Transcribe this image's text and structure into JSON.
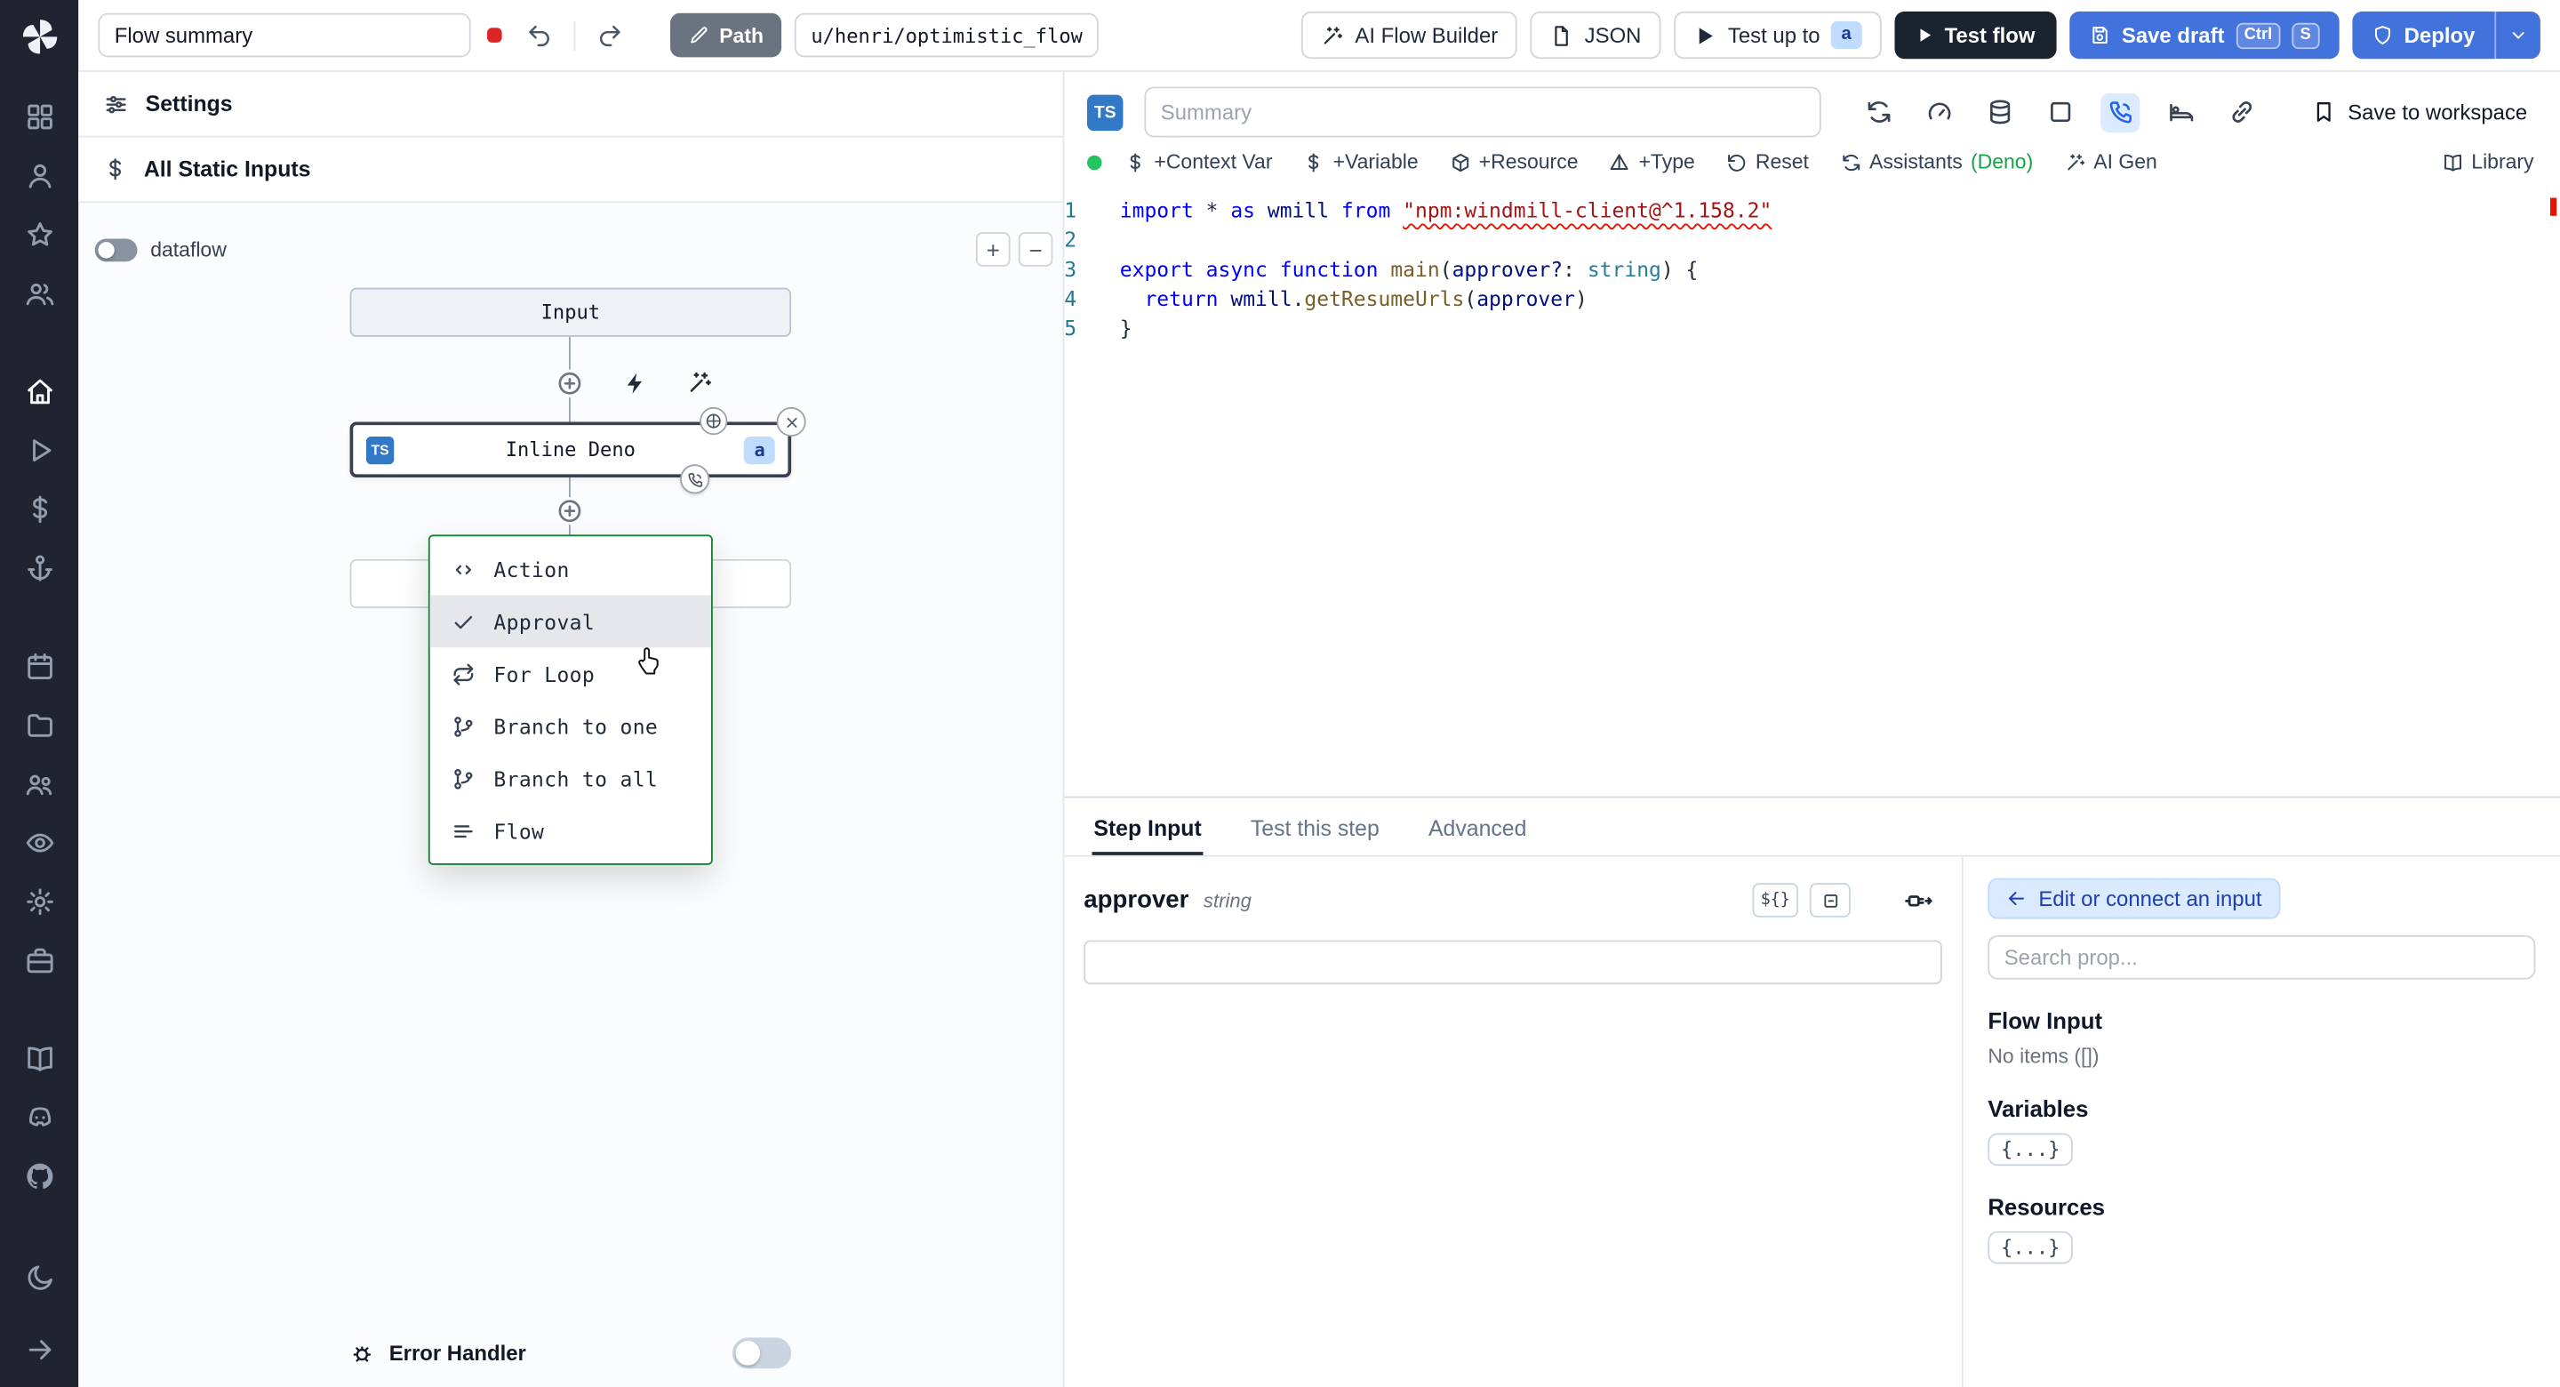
{
  "colors": {
    "accent_blue": "#4272dc",
    "badge_blue_bg": "#bfdbfe",
    "badge_blue_text": "#1e3a8a",
    "menu_green": "#178036",
    "dark_button": "#1b2330",
    "error_red": "#e51400",
    "status_green": "#22c55e"
  },
  "topbar": {
    "flow_summary_value": "Flow summary",
    "path_button": "Path",
    "path_value": "u/henri/optimistic_flow",
    "ai_flow_builder": "AI Flow Builder",
    "json_button": "JSON",
    "test_up_to": "Test up to",
    "test_up_to_badge": "a",
    "test_flow": "Test flow",
    "save_draft": "Save draft",
    "kbd_ctrl": "Ctrl",
    "kbd_s": "S",
    "deploy": "Deploy"
  },
  "sidebar": {
    "groups": [
      [
        {
          "id": "apps",
          "icon": "grid"
        },
        {
          "id": "user",
          "icon": "user"
        },
        {
          "id": "favorites",
          "icon": "star"
        },
        {
          "id": "members",
          "icon": "users"
        }
      ],
      [
        {
          "id": "home",
          "icon": "home",
          "active": true
        },
        {
          "id": "runs",
          "icon": "play"
        },
        {
          "id": "variables",
          "icon": "dollar"
        },
        {
          "id": "resources",
          "icon": "anchor"
        }
      ],
      [
        {
          "id": "schedules",
          "icon": "calendar"
        },
        {
          "id": "folders",
          "icon": "folder"
        },
        {
          "id": "groups",
          "icon": "group"
        },
        {
          "id": "audit-logs",
          "icon": "eye"
        },
        {
          "id": "settings",
          "icon": "gear"
        },
        {
          "id": "workers",
          "icon": "toolbox"
        }
      ],
      [
        {
          "id": "docs",
          "icon": "book"
        },
        {
          "id": "discord",
          "icon": "discord"
        },
        {
          "id": "github",
          "icon": "github"
        }
      ]
    ],
    "bottom": [
      {
        "id": "theme",
        "icon": "moon"
      },
      {
        "id": "collapse",
        "icon": "arrowright"
      }
    ]
  },
  "flow_panel": {
    "settings": "Settings",
    "static_inputs": "All Static Inputs",
    "dataflow": "dataflow",
    "zoom_in": "+",
    "zoom_out": "−",
    "input_node": "Input",
    "step_node": {
      "badge": "TS",
      "label": "Inline Deno",
      "suffix": "a"
    },
    "insert_menu": [
      {
        "icon": "code",
        "label": "Action"
      },
      {
        "icon": "check",
        "label": "Approval",
        "hover": true
      },
      {
        "icon": "repeat",
        "label": "For Loop"
      },
      {
        "icon": "branch",
        "label": "Branch to one"
      },
      {
        "icon": "branch",
        "label": "Branch to all"
      },
      {
        "icon": "flow",
        "label": "Flow"
      }
    ],
    "error_handler": "Error Handler"
  },
  "editor": {
    "lang_badge": "TS",
    "summary_placeholder": "Summary",
    "header_icons": [
      {
        "id": "sync"
      },
      {
        "id": "gauge"
      },
      {
        "id": "database"
      },
      {
        "id": "square"
      },
      {
        "id": "phone",
        "active": true
      },
      {
        "id": "bed"
      },
      {
        "id": "link"
      }
    ],
    "save_to_workspace": "Save to workspace",
    "toolbar": [
      {
        "icon": "dollar",
        "label": "+Context Var"
      },
      {
        "icon": "dollar",
        "label": "+Variable"
      },
      {
        "icon": "cube",
        "label": "+Resource"
      },
      {
        "icon": "pyramid",
        "label": "+Type"
      },
      {
        "icon": "reset",
        "label": "Reset"
      },
      {
        "icon": "sync",
        "label": "Assistants",
        "suffix": "(Deno)"
      },
      {
        "icon": "wand",
        "label": "AI Gen"
      }
    ],
    "library": "Library",
    "code_lines": [
      {
        "n": "1",
        "tokens": [
          {
            "t": "import",
            "c": "kw"
          },
          {
            "t": " * ",
            "c": "pl"
          },
          {
            "t": "as",
            "c": "kw"
          },
          {
            "t": " wmill ",
            "c": "id"
          },
          {
            "t": "from",
            "c": "kw"
          },
          {
            "t": " ",
            "c": "pl"
          },
          {
            "t": "\"npm:windmill-client@^1.158.2\"",
            "c": "str",
            "squiggle": true
          }
        ]
      },
      {
        "n": "2",
        "tokens": []
      },
      {
        "n": "3",
        "tokens": [
          {
            "t": "export",
            "c": "kw"
          },
          {
            "t": " ",
            "c": "pl"
          },
          {
            "t": "async",
            "c": "kw"
          },
          {
            "t": " ",
            "c": "pl"
          },
          {
            "t": "function",
            "c": "kw"
          },
          {
            "t": " ",
            "c": "pl"
          },
          {
            "t": "main",
            "c": "fn"
          },
          {
            "t": "(",
            "c": "pl"
          },
          {
            "t": "approver?",
            "c": "id"
          },
          {
            "t": ": ",
            "c": "pl"
          },
          {
            "t": "string",
            "c": "ty"
          },
          {
            "t": ") {",
            "c": "pl"
          }
        ]
      },
      {
        "n": "4",
        "tokens": [
          {
            "t": "  ",
            "c": "pl"
          },
          {
            "t": "return",
            "c": "kw"
          },
          {
            "t": " wmill",
            "c": "id"
          },
          {
            "t": ".",
            "c": "pl"
          },
          {
            "t": "getResumeUrls",
            "c": "fn"
          },
          {
            "t": "(",
            "c": "pl"
          },
          {
            "t": "approver",
            "c": "id"
          },
          {
            "t": ")",
            "c": "pl"
          }
        ]
      },
      {
        "n": "5",
        "tokens": [
          {
            "t": "}",
            "c": "pl"
          }
        ]
      }
    ]
  },
  "step_panel": {
    "tabs": [
      {
        "label": "Step Input",
        "active": true
      },
      {
        "label": "Test this step"
      },
      {
        "label": "Advanced"
      }
    ],
    "field_name": "approver",
    "field_type": "string",
    "expr_button": "${}",
    "connect_button": "Edit or connect an input",
    "search_placeholder": "Search prop...",
    "flow_input_title": "Flow Input",
    "flow_input_empty": "No items ([])",
    "variables_title": "Variables",
    "variables_button": "{...}",
    "resources_title": "Resources",
    "resources_button": "{...}"
  }
}
